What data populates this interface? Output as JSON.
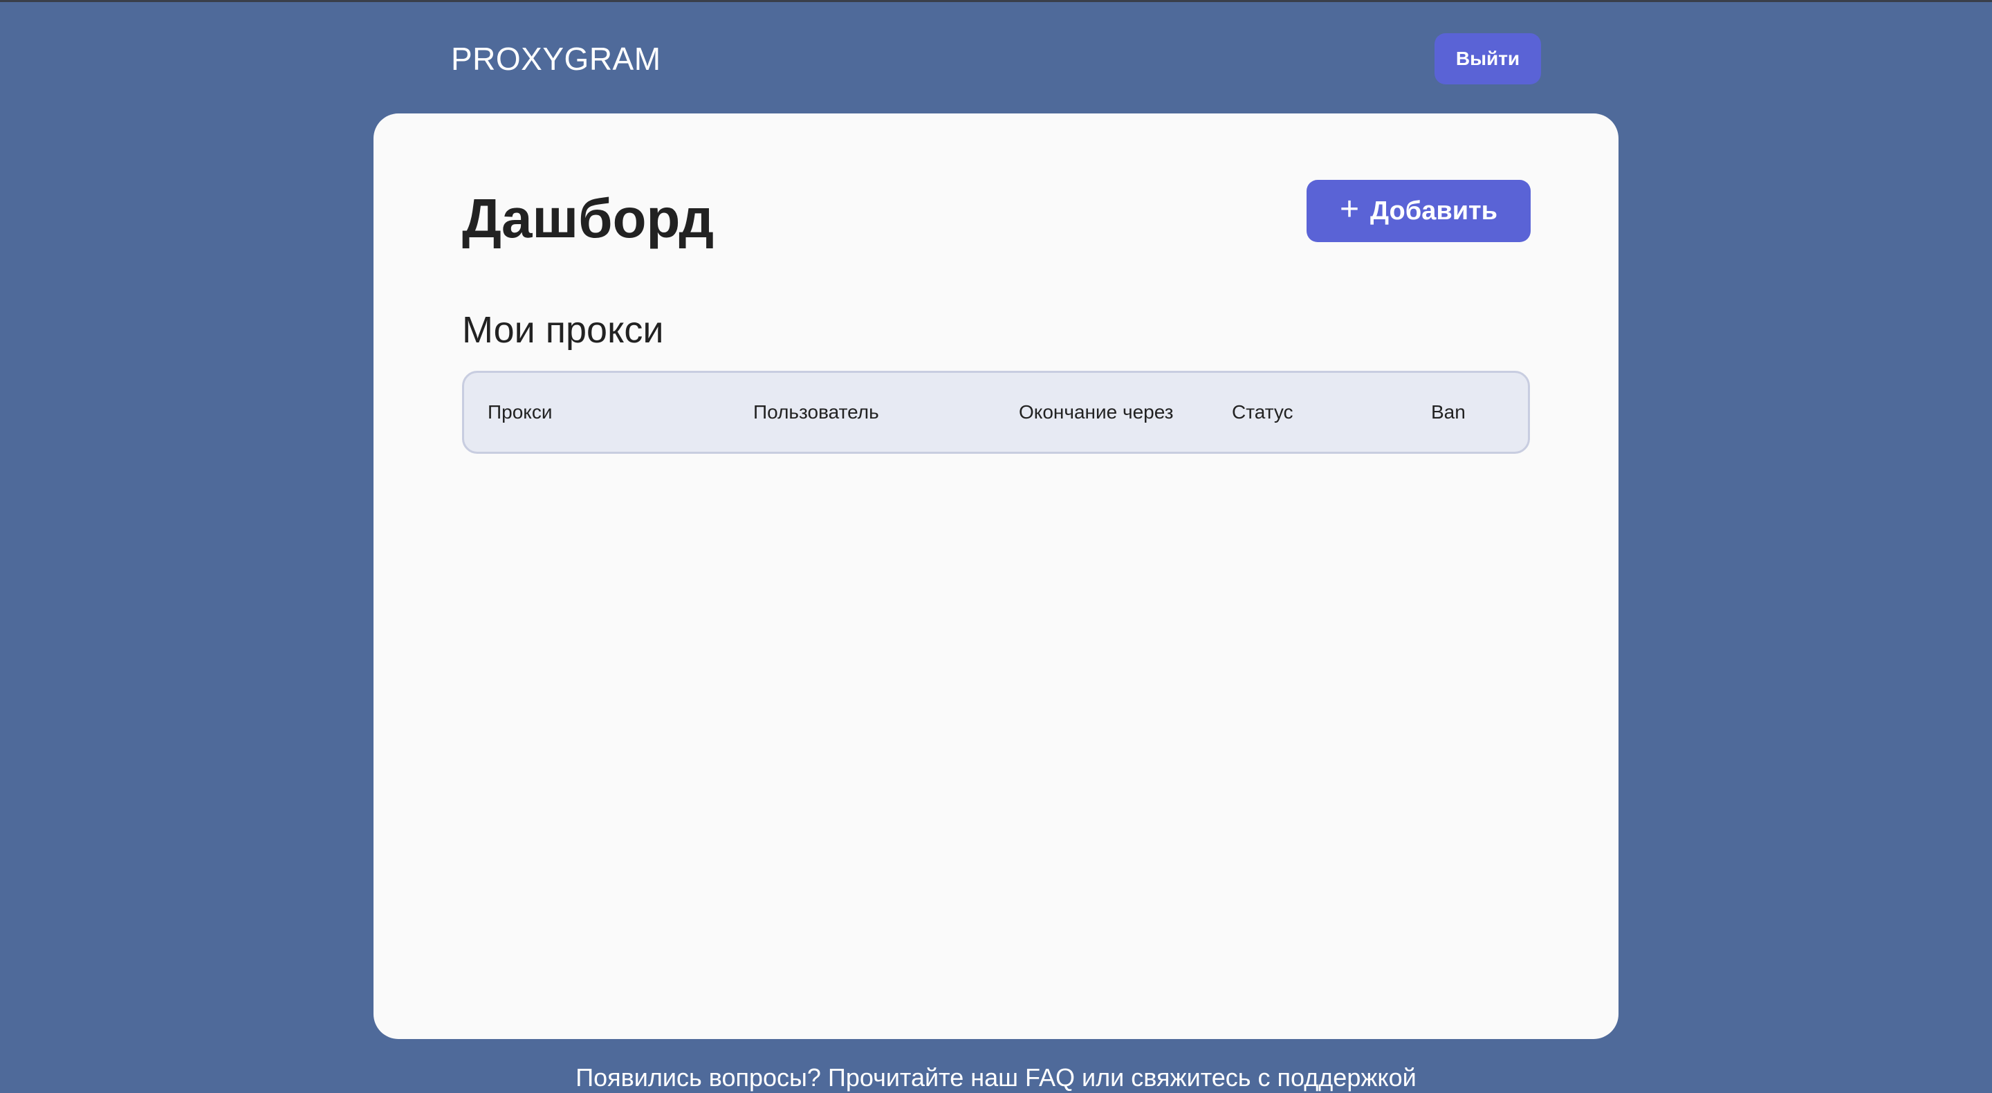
{
  "header": {
    "brand": "PROXYGRAM",
    "logout_label": "Выйти"
  },
  "dashboard": {
    "title": "Дашборд",
    "add_label": "Добавить",
    "add_icon": "plus-icon",
    "section_title": "Мои прокси"
  },
  "table": {
    "columns": [
      "Прокси",
      "Пользователь",
      "Окончание через",
      "Статус",
      "Ban"
    ]
  },
  "footer": {
    "text": "Появились вопросы? Прочитайте наш FAQ или свяжитесь с поддержкой"
  },
  "colors": {
    "background": "#4f6a9a",
    "accent": "#5a63d6",
    "card": "#fafafa",
    "table_header": "#e7eaf3"
  }
}
